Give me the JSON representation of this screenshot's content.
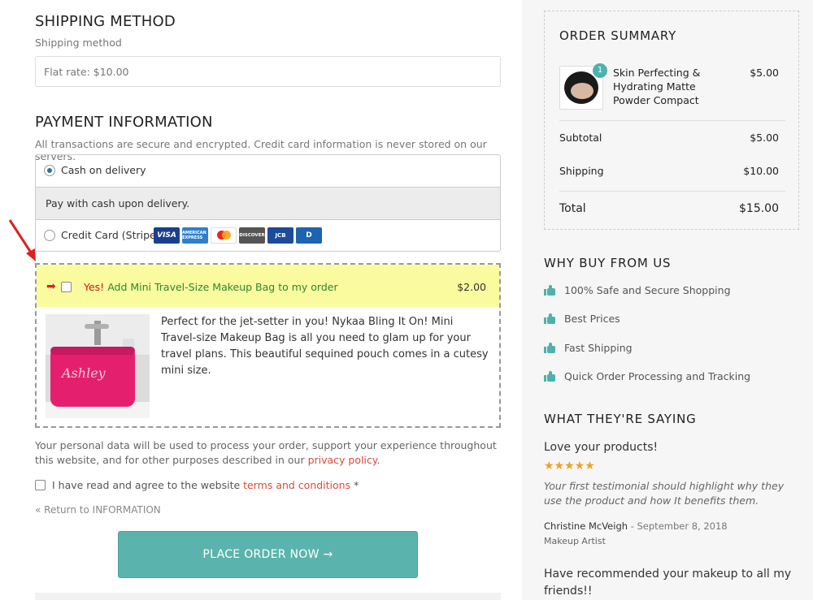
{
  "shipping": {
    "heading": "SHIPPING METHOD",
    "label": "Shipping method",
    "value": "Flat rate: $10.00"
  },
  "payment": {
    "heading": "PAYMENT INFORMATION",
    "note": "All transactions are secure and encrypted. Credit card information is never stored on our servers.",
    "options": [
      {
        "label": "Cash on delivery",
        "selected": true,
        "description": "Pay with cash upon delivery."
      },
      {
        "label": "Credit Card (Stripe)",
        "selected": false
      }
    ],
    "card_icons": [
      "visa",
      "american-express",
      "mastercard",
      "discover",
      "jcb",
      "diners-club"
    ],
    "card_labels": {
      "visa": "VISA",
      "amex": "AMERICAN EXPRESS",
      "discover": "DISCOVER",
      "jcb": "JCB",
      "diners": "D"
    }
  },
  "upsell": {
    "yes": "Yes!",
    "title": "Add Mini Travel-Size Makeup Bag to my order",
    "price": "$2.00",
    "description": "Perfect for the jet-setter in you! Nykaa Bling It On! Mini Travel-size Makeup Bag is all you need to glam up for your travel plans. This beautiful sequined pouch comes in a cutesy mini size.",
    "image_text": "Ashley",
    "highlight_color": "#fafa9e"
  },
  "privacy": {
    "before": "Your personal data will be used to process your order, support your experience throughout this website, and for other purposes described in our ",
    "link": "privacy policy",
    "after": "."
  },
  "terms": {
    "before": "I have read and agree to the website ",
    "link": "terms and conditions",
    "after": " *"
  },
  "return_link": "« Return to INFORMATION",
  "place_order": "PLACE ORDER NOW →",
  "accent_color": "#5ab4ad",
  "summary": {
    "heading": "ORDER SUMMARY",
    "item": {
      "name": "Skin Perfecting & Hydrating Matte Powder Compact",
      "quantity": "1",
      "price": "$5.00"
    },
    "subtotal_label": "Subtotal",
    "subtotal": "$5.00",
    "shipping_label": "Shipping",
    "shipping": "$10.00",
    "total_label": "Total",
    "total": "$15.00"
  },
  "why": {
    "heading": "WHY BUY FROM US",
    "items": [
      "100% Safe and Secure Shopping",
      "Best Prices",
      "Fast Shipping",
      "Quick Order Processing and Tracking"
    ]
  },
  "testimonials": {
    "heading": "WHAT THEY'RE SAYING",
    "first": {
      "title": "Love your products!",
      "stars": "★★★★★",
      "text": "Your first testimonial should highlight why they use the product and how It benefits them.",
      "author": "Christine McVeigh",
      "date": " - September 8, 2018",
      "role": "Makeup Artist"
    },
    "second_title": "Have recommended your makeup to all my friends!!"
  }
}
